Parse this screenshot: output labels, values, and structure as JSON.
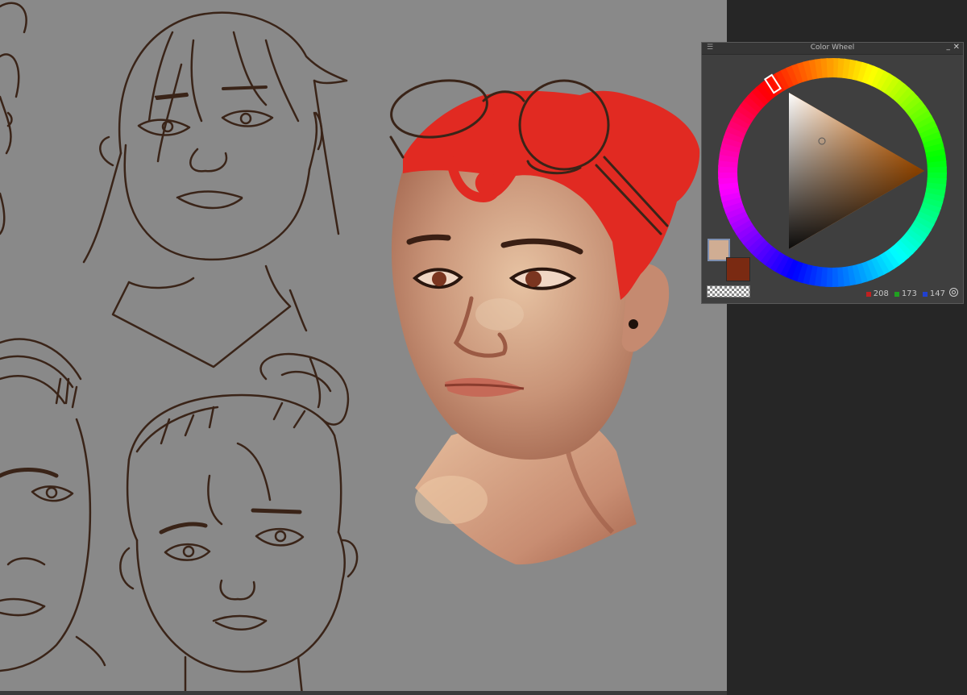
{
  "color_wheel": {
    "title": "Color Wheel",
    "rgb": {
      "r": "208",
      "g": "173",
      "b": "147"
    },
    "main_color": "#d0ad93",
    "sub_color": "#7a2a12",
    "selected_hue_color": "#ff7a00"
  },
  "canvas": {
    "background": "#898989",
    "line_color": "#3a2418",
    "hair_color": "#e12a22",
    "skin_color": "#e2b795"
  }
}
